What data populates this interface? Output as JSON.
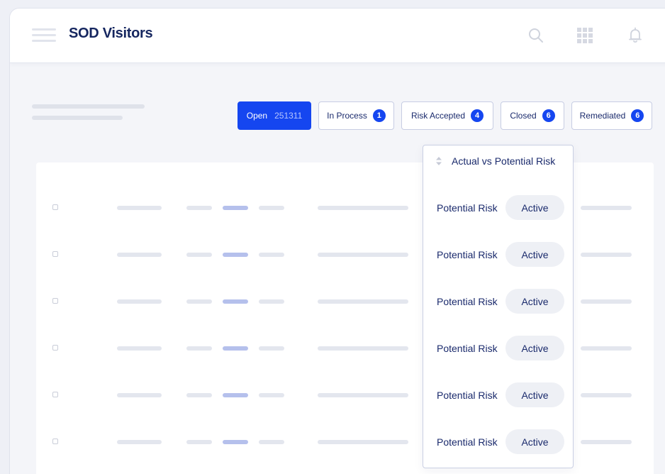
{
  "header": {
    "title": "SOD Visitors",
    "icons": [
      "menu-icon",
      "search-icon",
      "apps-grid-icon",
      "bell-icon"
    ]
  },
  "tabs": [
    {
      "label": "Open",
      "count": "251311",
      "active": true
    },
    {
      "label": "In Process",
      "count": "1",
      "active": false
    },
    {
      "label": "Risk Accepted",
      "count": "4",
      "active": false
    },
    {
      "label": "Closed",
      "count": "6",
      "active": false
    },
    {
      "label": "Remediated",
      "count": "6",
      "active": false
    }
  ],
  "risk_column": {
    "title": "Actual vs Potential Risk",
    "rows": [
      {
        "label": "Potential Risk",
        "status": "Active"
      },
      {
        "label": "Potential Risk",
        "status": "Active"
      },
      {
        "label": "Potential Risk",
        "status": "Active"
      },
      {
        "label": "Potential Risk",
        "status": "Active"
      },
      {
        "label": "Potential Risk",
        "status": "Active"
      },
      {
        "label": "Potential Risk",
        "status": "Active"
      }
    ]
  },
  "colors": {
    "accent": "#1546f0",
    "title": "#15265f",
    "pill_bg": "#eef0f5",
    "placeholder": "#e3e6ee",
    "placeholder_accent": "#b5c0ec"
  }
}
